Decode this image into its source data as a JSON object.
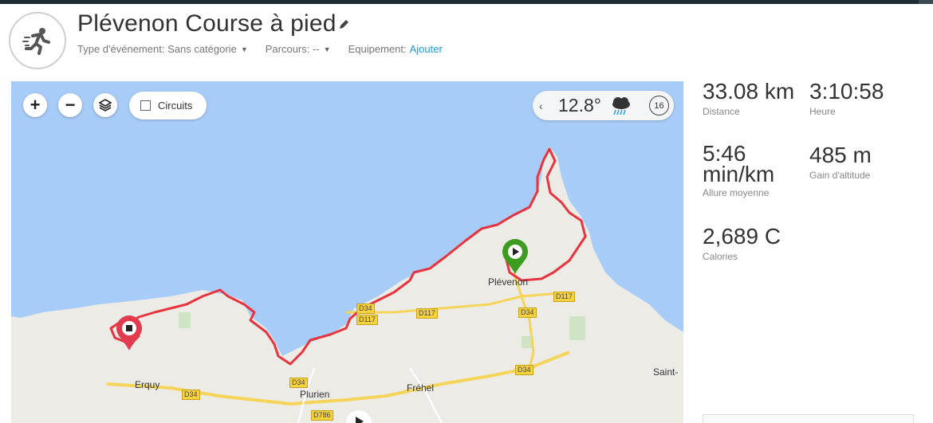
{
  "activity": {
    "title": "Plévenon Course à pied",
    "icon": "runner-icon",
    "event_type_label": "Type d'événement:",
    "event_type_value": "Sans catégorie",
    "course_label": "Parcours:",
    "course_value": "--",
    "equipment_label": "Equipement:",
    "equipment_link": "Ajouter"
  },
  "map": {
    "zoom_in": "+",
    "zoom_out": "−",
    "circuits_label": "Circuits",
    "weather": {
      "temperature": "12.8°",
      "icon": "rain-cloud-icon",
      "wind": "16"
    },
    "places": {
      "plevenon": "Plévenon",
      "erquy": "Erquy",
      "plurien": "Plurien",
      "frehel": "Fréhel",
      "saint": "Saint-"
    },
    "roads": {
      "d34_a": "D34",
      "d117_a": "D117",
      "d117_b": "D117",
      "d34_b": "D34",
      "d117_c": "D117",
      "d34_c": "D34",
      "d34_d": "D34",
      "d34_e": "D34",
      "d786": "D786"
    }
  },
  "stats": {
    "distance_value": "33.08 km",
    "distance_label": "Distance",
    "time_value": "3:10:58",
    "time_label": "Heure",
    "pace_value_line1": "5:46",
    "pace_value_line2": "min/km",
    "pace_label": "Allure moyenne",
    "elevation_value": "485 m",
    "elevation_label": "Gain d'altitude",
    "calories_value": "2,689 C",
    "calories_label": "Calories"
  },
  "colors": {
    "route": "#e8343f",
    "start_pin": "#3c9c1f",
    "end_pin": "#e23a4e",
    "sea": "#a8ccf8",
    "land": "#ecebe6",
    "link": "#1a9ad6"
  }
}
